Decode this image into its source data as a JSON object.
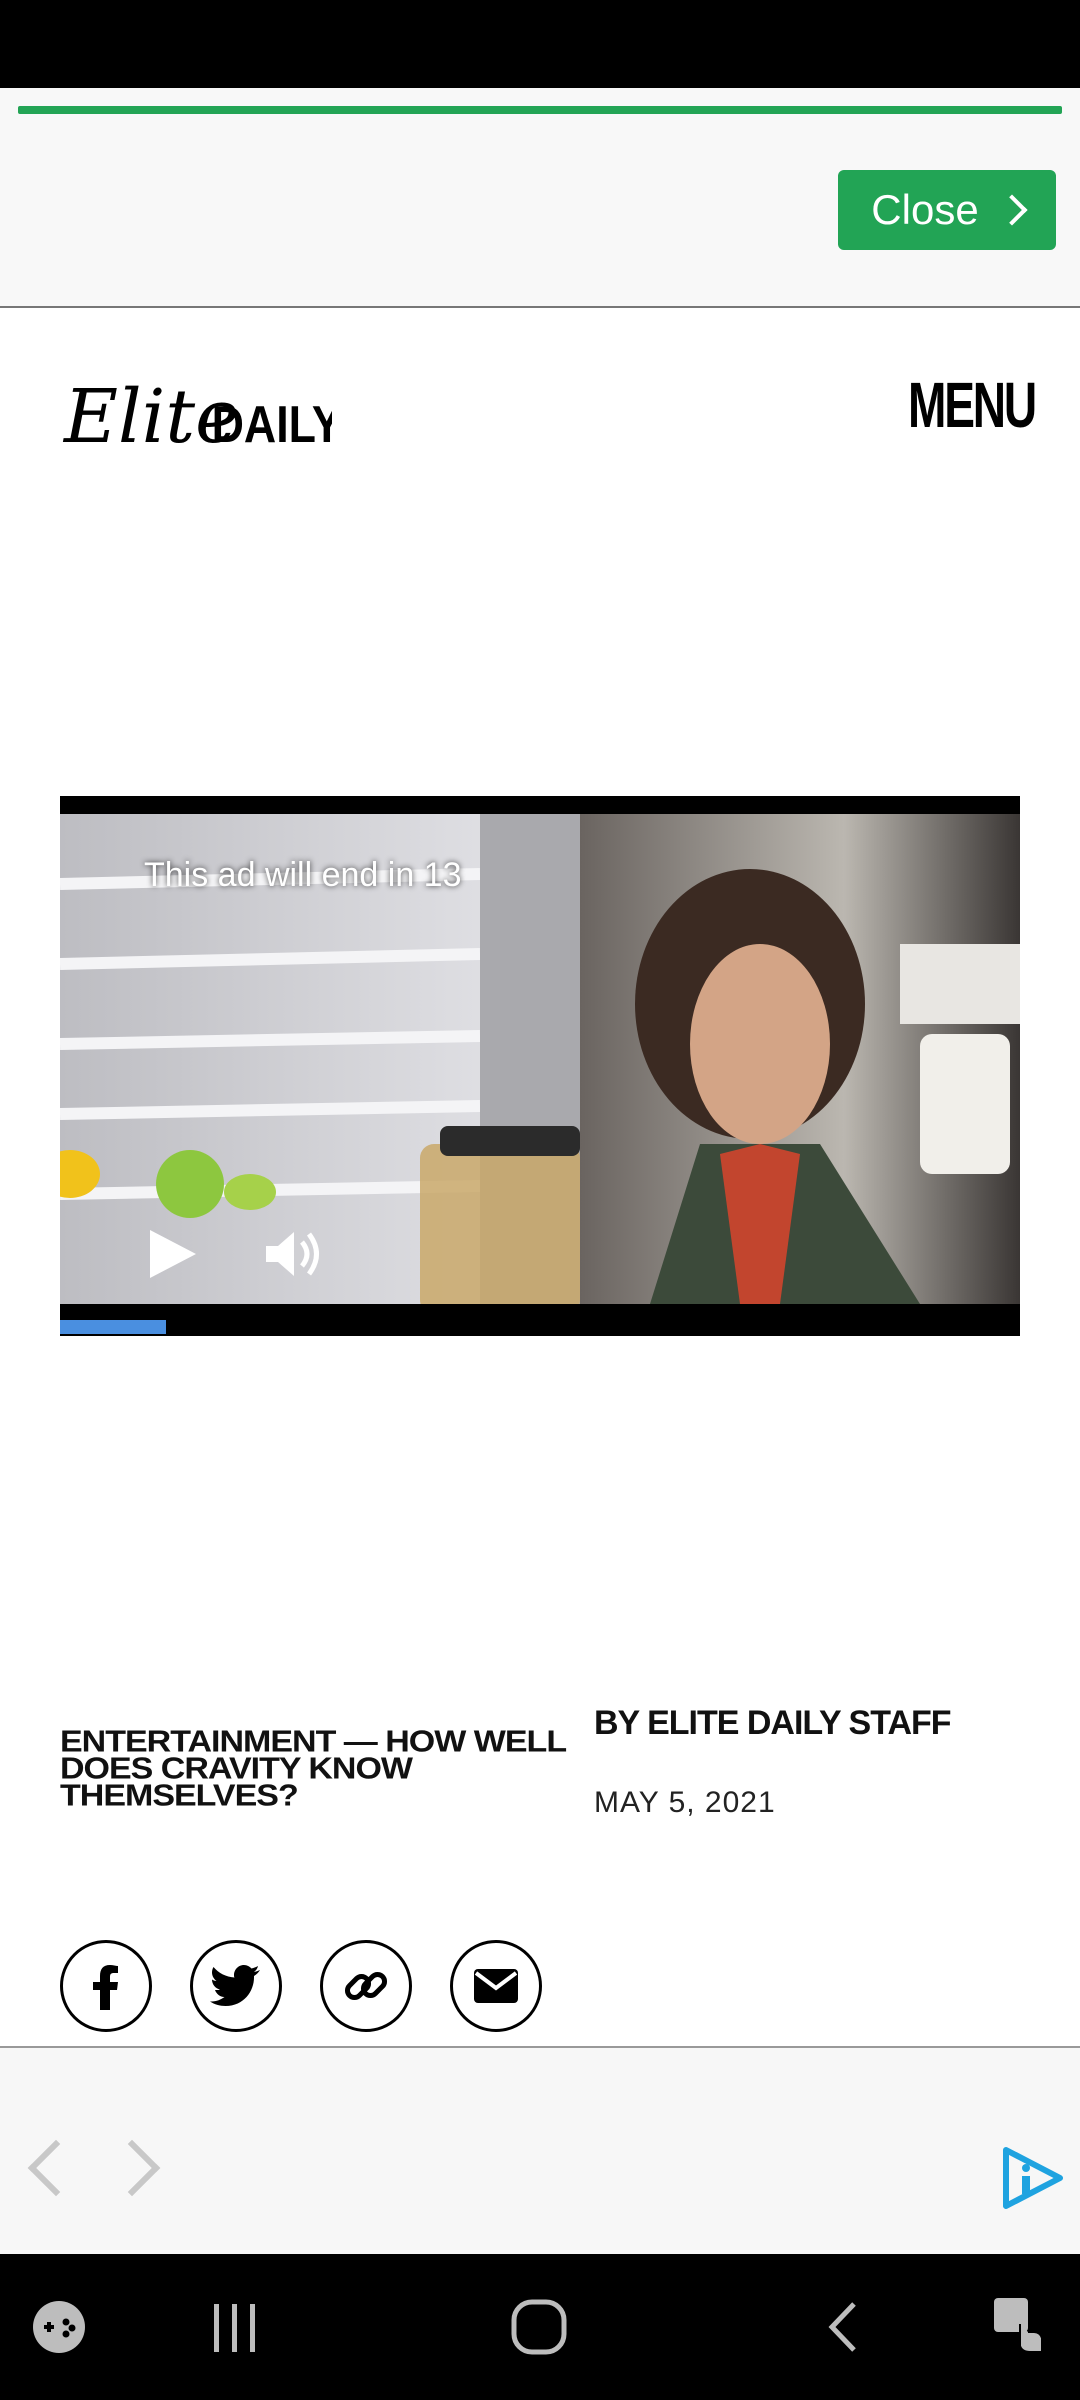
{
  "ad_banner": {
    "close_label": "Close",
    "progress_color": "#23a455"
  },
  "header": {
    "logo_text": "Elite DAILY",
    "logo_script": "Elite",
    "logo_block": "DAILY",
    "menu_label": "MENU"
  },
  "video_ad": {
    "countdown_text": "This ad will end in 13",
    "progress_fraction": 0.11,
    "progress_color": "#4a8fe0",
    "controls": [
      "play-icon",
      "volume-icon"
    ]
  },
  "article": {
    "headline": "Entertainment — How well does Cravity know themselves?",
    "byline": "By Elite Daily Staff",
    "date": "MAY 5, 2021"
  },
  "share": {
    "buttons": [
      "facebook-icon",
      "twitter-icon",
      "link-icon",
      "email-icon"
    ]
  },
  "bottom_ad": {
    "prev": "chevron-left-icon",
    "next": "chevron-right-icon",
    "adchoices": "adchoices-icon"
  },
  "system_nav": {
    "items": [
      "game-launcher-icon",
      "recents-icon",
      "home-icon",
      "back-icon",
      "accessibility-icon"
    ]
  }
}
